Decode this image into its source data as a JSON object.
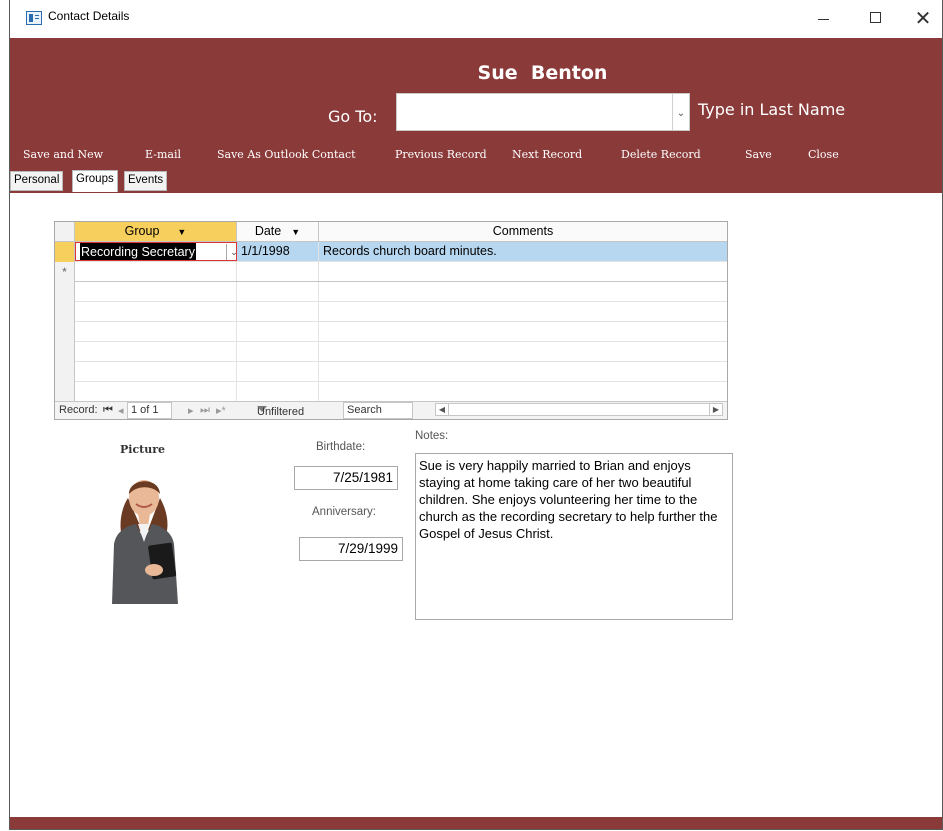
{
  "window": {
    "title": "Contact Details",
    "close_glyph": "✕"
  },
  "header": {
    "contact_name": "Sue  Benton",
    "goto_label": "Go To:",
    "goto_value": "",
    "type_hint": "Type in Last Name",
    "actions": [
      "Save and New",
      "E-mail",
      "Save As Outlook Contact",
      "Previous Record",
      "Next Record",
      "Delete Record",
      "Save",
      "Close"
    ]
  },
  "tabs": [
    {
      "label": "Personal",
      "active": false
    },
    {
      "label": "Groups",
      "active": true
    },
    {
      "label": "Events",
      "active": false
    }
  ],
  "groups_table": {
    "columns": [
      "Group",
      "Date",
      "Comments"
    ],
    "rows": [
      {
        "group": "Recording Secretary",
        "date": "1/1/1998",
        "comments": "Records church board minutes."
      }
    ],
    "new_row_marker": "*",
    "navigation": {
      "record_label": "Record:",
      "position": "1 of 1",
      "filter_state": "Unfiltered",
      "search_label": "Search"
    }
  },
  "details": {
    "picture_label": "Picture",
    "birthdate_label": "Birthdate:",
    "birthdate": "7/25/1981",
    "anniversary_label": "Anniversary:",
    "anniversary": "7/29/1999",
    "notes_label": "Notes:",
    "notes": "Sue is very happily married to Brian and enjoys staying at home taking care of her two beautiful children. She enjoys volunteering her time to the church as the recording secretary to help further the Gospel of Jesus Christ."
  },
  "colors": {
    "brand": "#8b3a3a",
    "selected_header": "#f7cf5c",
    "selected_row": "#b7d7f0"
  }
}
